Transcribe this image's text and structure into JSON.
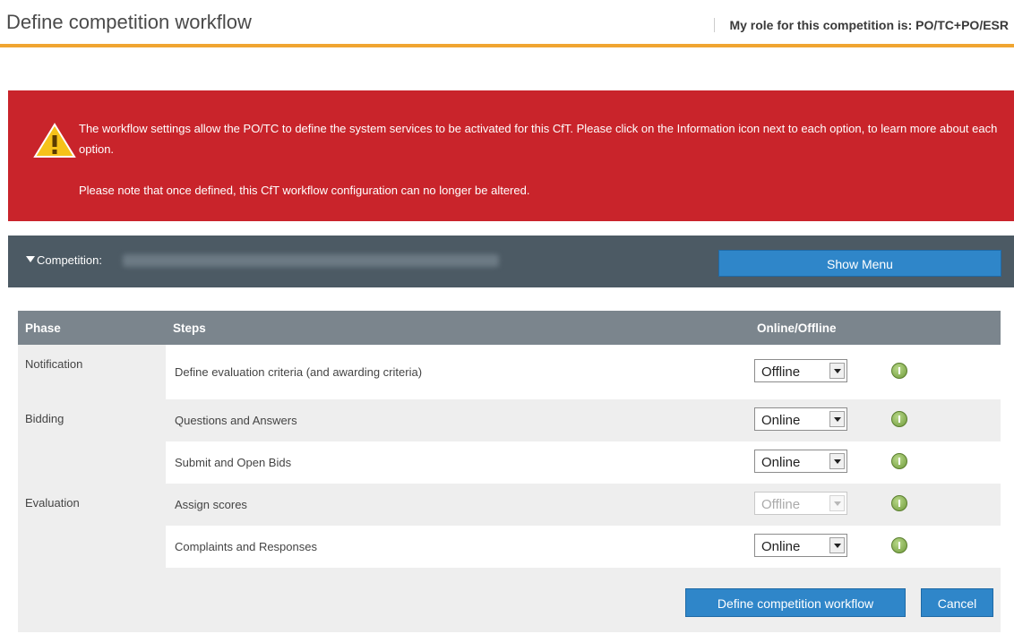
{
  "header": {
    "title": "Define competition workflow",
    "role": "My role for this competition is: PO/TC+PO/ESR"
  },
  "alert": {
    "icon": "warning-icon",
    "line1": "The workflow settings allow the PO/TC to define the system services to be activated for this CfT. Please click on the Information icon next to each option, to learn more about each option.",
    "line2": "Please note that once defined, this CfT workflow configuration can no longer be altered.",
    "color": "#c9242b"
  },
  "competition": {
    "label": "Competition:",
    "show_menu": "Show Menu"
  },
  "table": {
    "headers": {
      "phase": "Phase",
      "steps": "Steps",
      "online": "Online/Offline"
    },
    "rows": [
      {
        "phase": "Notification",
        "step": "Define evaluation criteria (and awarding criteria)",
        "value": "Offline",
        "disabled": false
      },
      {
        "phase": "Bidding",
        "step": "Questions and Answers",
        "value": "Online",
        "disabled": false
      },
      {
        "phase": "",
        "step": "Submit and Open Bids",
        "value": "Online",
        "disabled": false
      },
      {
        "phase": "Evaluation",
        "step": "Assign scores",
        "value": "Offline",
        "disabled": true
      },
      {
        "phase": "",
        "step": "Complaints and Responses",
        "value": "Online",
        "disabled": false
      }
    ]
  },
  "actions": {
    "define": "Define competition workflow",
    "cancel": "Cancel"
  },
  "colors": {
    "accent": "#f0a531",
    "button": "#2f86c9",
    "bar": "#4c5a64",
    "header_row": "#7b858d"
  }
}
